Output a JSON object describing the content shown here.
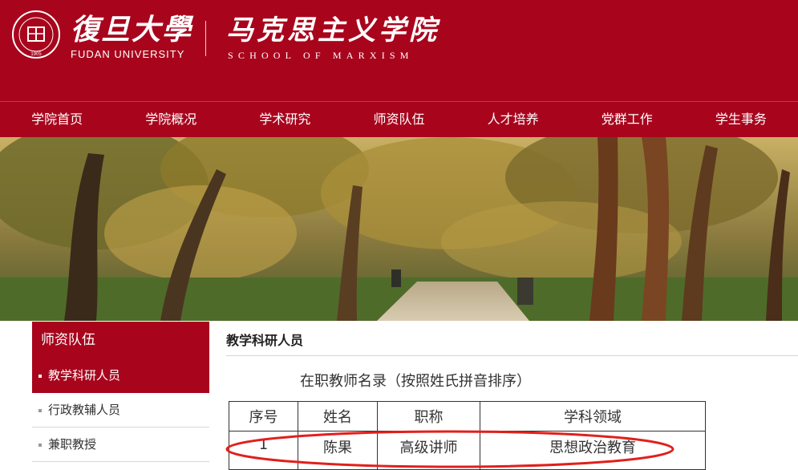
{
  "header": {
    "university_cn": "復旦大學",
    "university_en": "FUDAN UNIVERSITY",
    "seal_year": "1905",
    "seal_text": "FUDAN UNIVERSITY",
    "school_cn": "马克思主义学院",
    "school_en": "SCHOOL OF MARXISM",
    "brand_color": "#a8051d"
  },
  "nav": {
    "items": [
      {
        "label": "学院首页"
      },
      {
        "label": "学院概况"
      },
      {
        "label": "学术研究"
      },
      {
        "label": "师资队伍"
      },
      {
        "label": "人才培养"
      },
      {
        "label": "党群工作"
      },
      {
        "label": "学生事务"
      }
    ]
  },
  "banner": {
    "icon": "campus-trees-photo"
  },
  "sidebar": {
    "title": "师资队伍",
    "items": [
      {
        "label": "教学科研人员",
        "active": true
      },
      {
        "label": "行政教辅人员",
        "active": false
      },
      {
        "label": "兼职教授",
        "active": false
      }
    ]
  },
  "main": {
    "title": "教学科研人员",
    "list_heading": "在职教师名录（按照姓氏拼音排序）",
    "table": {
      "headers": [
        "序号",
        "姓名",
        "职称",
        "学科领域"
      ],
      "rows": [
        [
          "1",
          "陈果",
          "高级讲师",
          "思想政治教育"
        ]
      ]
    },
    "highlight_color": "#e0201c"
  }
}
